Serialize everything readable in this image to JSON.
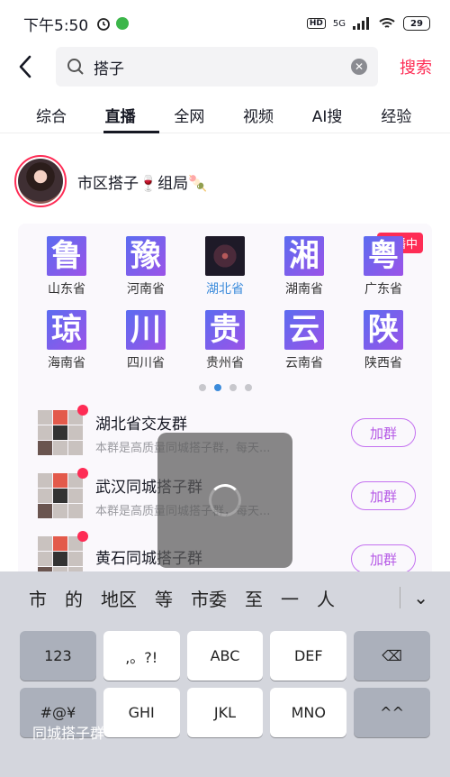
{
  "status": {
    "time": "下午5:50",
    "network": "5G",
    "battery": "29"
  },
  "search": {
    "query": "搭子",
    "button": "搜索"
  },
  "tabs": [
    "综合",
    "直播",
    "全网",
    "视频",
    "AI搜",
    "经验"
  ],
  "group": {
    "title": "市区搭子🍷组局🍡"
  },
  "live_badge": "直播中",
  "provinces": [
    {
      "char": "鲁",
      "name": "山东省"
    },
    {
      "char": "豫",
      "name": "河南省"
    },
    {
      "char": "",
      "name": "湖北省"
    },
    {
      "char": "湘",
      "name": "湖南省"
    },
    {
      "char": "粤",
      "name": "广东省"
    },
    {
      "char": "琼",
      "name": "海南省"
    },
    {
      "char": "川",
      "name": "四川省"
    },
    {
      "char": "贵",
      "name": "贵州省"
    },
    {
      "char": "云",
      "name": "云南省"
    },
    {
      "char": "陕",
      "name": "陕西省"
    }
  ],
  "groups": [
    {
      "name": "湖北省交友群",
      "desc": "本群是高质量同城搭子群，每天...",
      "btn": "加群"
    },
    {
      "name": "武汉同城搭子群",
      "desc": "本群是高质量同城搭子群，每天...",
      "btn": "加群"
    },
    {
      "name": "黄石同城搭子群",
      "desc": "",
      "btn": "加群"
    }
  ],
  "keyboard": {
    "candidates": [
      "市",
      "的",
      "地区",
      "等",
      "市委",
      "至",
      "一",
      "人"
    ],
    "row1": [
      "123",
      ",。?!",
      "ABC",
      "DEF",
      "⌫"
    ],
    "row2": [
      "#@¥",
      "GHI",
      "JKL",
      "MNO",
      "^^"
    ]
  },
  "overlay_text": "同城搭子群"
}
